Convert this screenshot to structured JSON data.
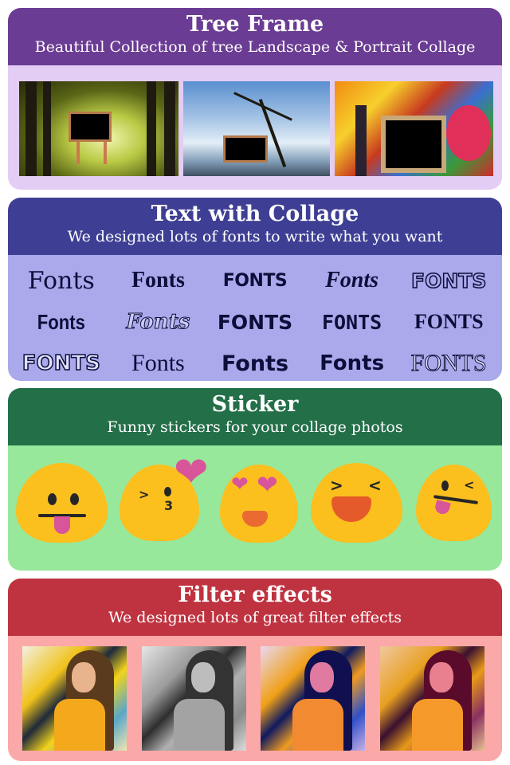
{
  "sections": {
    "tree": {
      "title": "Tree Frame",
      "subtitle": "Beautiful Collection of tree Landscape & Portrait Collage",
      "header_color": "#6b3c93",
      "body_color": "#e4cdf4",
      "images": [
        "forest-path-signboard-frame",
        "bare-tree-hanging-frame",
        "autumn-tree-wooden-frame"
      ]
    },
    "text": {
      "title": "Text with Collage",
      "subtitle": "We designed lots of fonts to write what you want",
      "header_color": "#3e3f94",
      "body_color": "#aaa9ec",
      "samples": [
        "Fonts",
        "Fonts",
        "FONTS",
        "Fonts",
        "FONTS",
        "Fonts",
        "Fonts",
        "FONTS",
        "FONTS",
        "FONTS",
        "FONTS",
        "Fonts",
        "Fonts",
        "Fonts",
        "FONTS"
      ]
    },
    "sticker": {
      "title": "Sticker",
      "subtitle": "Funny stickers for your collage photos",
      "header_color": "#236f48",
      "body_color": "#97e89a",
      "stickers": [
        "tongue-out-emoji",
        "kissing-heart-emoji",
        "heart-eyes-emoji",
        "laughing-squint-emoji",
        "winking-tongue-emoji"
      ]
    },
    "filter": {
      "title": "Filter effects",
      "subtitle": "We designed lots of great filter effects",
      "header_color": "#bf3340",
      "body_color": "#fba8a8",
      "filters": [
        "original",
        "grayscale",
        "purple-tint",
        "warm-magenta-tint"
      ]
    }
  }
}
